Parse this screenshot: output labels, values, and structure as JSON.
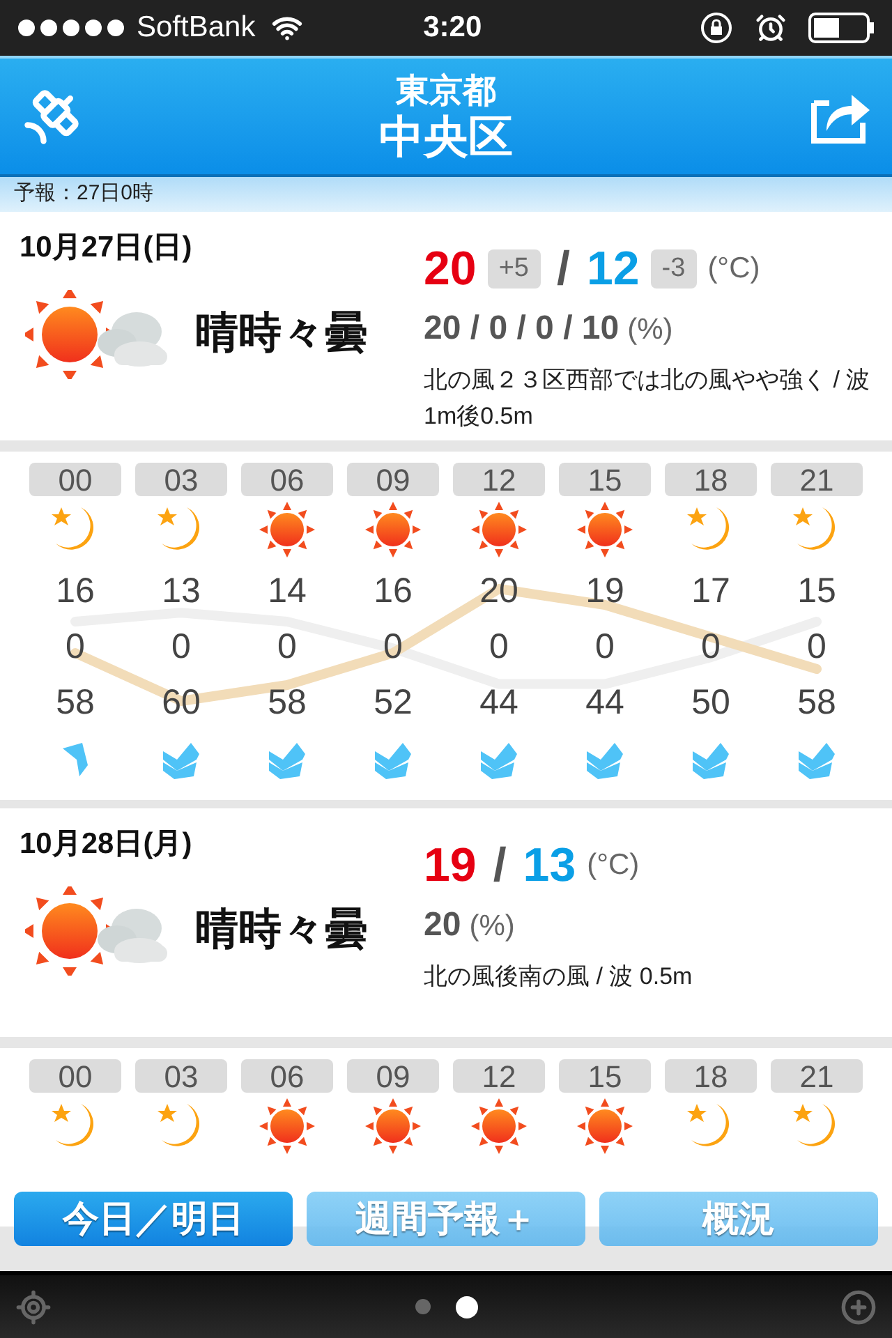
{
  "status_bar": {
    "carrier": "SoftBank",
    "time": "3:20"
  },
  "header": {
    "prefecture": "東京都",
    "city": "中央区"
  },
  "forecast_time": "予報：27日0時",
  "days": [
    {
      "date": "10月27日(日)",
      "weather": "晴時々曇",
      "high": "20",
      "high_diff": "+5",
      "separator": "/",
      "low": "12",
      "low_diff": "-3",
      "unit": "(°C)",
      "precip": "20 / 0 / 0 / 10",
      "precip_unit": "(%)",
      "wind_wave": "北の風２３区西部では北の風やや強く / 波 1m後0.5m",
      "hourly": [
        {
          "hour": "00",
          "kind": "moon",
          "temp": "16",
          "precip": "0",
          "humidity": "58",
          "wind": {
            "kind": "single"
          }
        },
        {
          "hour": "03",
          "kind": "moon",
          "temp": "13",
          "precip": "0",
          "humidity": "60",
          "wind": {
            "kind": "double"
          }
        },
        {
          "hour": "06",
          "kind": "sun",
          "temp": "14",
          "precip": "0",
          "humidity": "58",
          "wind": {
            "kind": "double"
          }
        },
        {
          "hour": "09",
          "kind": "sun",
          "temp": "16",
          "precip": "0",
          "humidity": "52",
          "wind": {
            "kind": "double"
          }
        },
        {
          "hour": "12",
          "kind": "sun",
          "temp": "20",
          "precip": "0",
          "humidity": "44",
          "wind": {
            "kind": "double"
          }
        },
        {
          "hour": "15",
          "kind": "sun",
          "temp": "19",
          "precip": "0",
          "humidity": "44",
          "wind": {
            "kind": "double"
          }
        },
        {
          "hour": "18",
          "kind": "moon",
          "temp": "17",
          "precip": "0",
          "humidity": "50",
          "wind": {
            "kind": "double"
          }
        },
        {
          "hour": "21",
          "kind": "moon",
          "temp": "15",
          "precip": "0",
          "humidity": "58",
          "wind": {
            "kind": "double"
          }
        }
      ]
    },
    {
      "date": "10月28日(月)",
      "weather": "晴時々曇",
      "high": "19",
      "separator": "/",
      "low": "13",
      "unit": "(°C)",
      "precip": "20",
      "precip_unit": "(%)",
      "wind_wave": "北の風後南の風 / 波 0.5m",
      "hourly": [
        {
          "hour": "00",
          "kind": "moon"
        },
        {
          "hour": "03",
          "kind": "moon"
        },
        {
          "hour": "06",
          "kind": "sun"
        },
        {
          "hour": "09",
          "kind": "sun"
        },
        {
          "hour": "12",
          "kind": "sun"
        },
        {
          "hour": "15",
          "kind": "sun"
        },
        {
          "hour": "18",
          "kind": "moon"
        },
        {
          "hour": "21",
          "kind": "moon"
        }
      ]
    }
  ],
  "tabs": [
    {
      "label": "今日／明日",
      "selected": true
    },
    {
      "label": "週間予報＋",
      "selected": false
    },
    {
      "label": "概況",
      "selected": false
    }
  ],
  "page_dots": [
    {
      "selected": false
    },
    {
      "selected": true
    }
  ]
}
